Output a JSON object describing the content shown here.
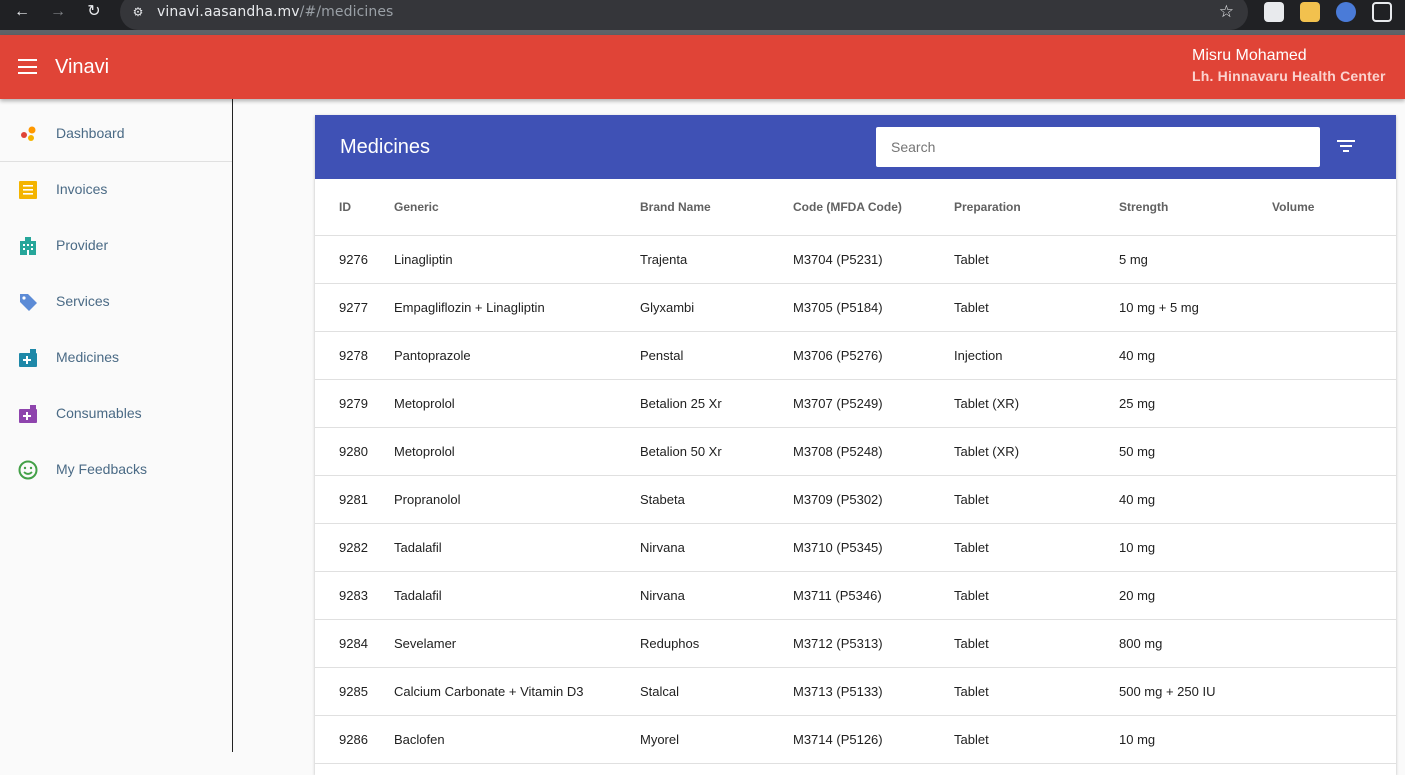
{
  "browser": {
    "url_host": "vinavi.aasandha.mv",
    "url_path": "/#/medicines"
  },
  "app": {
    "title": "Vinavi",
    "user_name": "Misru Mohamed",
    "user_center": "Lh. Hinnavaru Health Center",
    "accent_color": "#e04437"
  },
  "sidebar": {
    "items": [
      {
        "label": "Dashboard",
        "icon": "dashboard-dots-icon"
      },
      {
        "label": "Invoices",
        "icon": "invoice-icon"
      },
      {
        "label": "Provider",
        "icon": "building-icon"
      },
      {
        "label": "Services",
        "icon": "tag-icon"
      },
      {
        "label": "Medicines",
        "icon": "medical-bag-icon"
      },
      {
        "label": "Consumables",
        "icon": "medical-bag-icon"
      },
      {
        "label": "My Feedbacks",
        "icon": "smiley-icon"
      }
    ]
  },
  "medicines": {
    "title": "Medicines",
    "search_placeholder": "Search",
    "header_color": "#3f51b5",
    "columns": [
      "ID",
      "Generic",
      "Brand Name",
      "Code (MFDA Code)",
      "Preparation",
      "Strength",
      "Volume"
    ],
    "rows": [
      [
        "9276",
        "Linagliptin",
        "Trajenta",
        "M3704 (P5231)",
        "Tablet",
        "5 mg",
        ""
      ],
      [
        "9277",
        "Empagliflozin + Linagliptin",
        "Glyxambi",
        "M3705 (P5184)",
        "Tablet",
        "10 mg + 5 mg",
        ""
      ],
      [
        "9278",
        "Pantoprazole",
        "Penstal",
        "M3706 (P5276)",
        "Injection",
        "40 mg",
        ""
      ],
      [
        "9279",
        "Metoprolol",
        "Betalion 25 Xr",
        "M3707 (P5249)",
        "Tablet (XR)",
        "25 mg",
        ""
      ],
      [
        "9280",
        "Metoprolol",
        "Betalion 50 Xr",
        "M3708 (P5248)",
        "Tablet (XR)",
        "50 mg",
        ""
      ],
      [
        "9281",
        "Propranolol",
        "Stabeta",
        "M3709 (P5302)",
        "Tablet",
        "40 mg",
        ""
      ],
      [
        "9282",
        "Tadalafil",
        "Nirvana",
        "M3710 (P5345)",
        "Tablet",
        "10 mg",
        ""
      ],
      [
        "9283",
        "Tadalafil",
        "Nirvana",
        "M3711 (P5346)",
        "Tablet",
        "20 mg",
        ""
      ],
      [
        "9284",
        "Sevelamer",
        "Reduphos",
        "M3712 (P5313)",
        "Tablet",
        "800 mg",
        ""
      ],
      [
        "9285",
        "Calcium Carbonate + Vitamin D3",
        "Stalcal",
        "M3713 (P5133)",
        "Tablet",
        "500 mg + 250 IU",
        ""
      ],
      [
        "9286",
        "Baclofen",
        "Myorel",
        "M3714 (P5126)",
        "Tablet",
        "10 mg",
        ""
      ]
    ]
  }
}
